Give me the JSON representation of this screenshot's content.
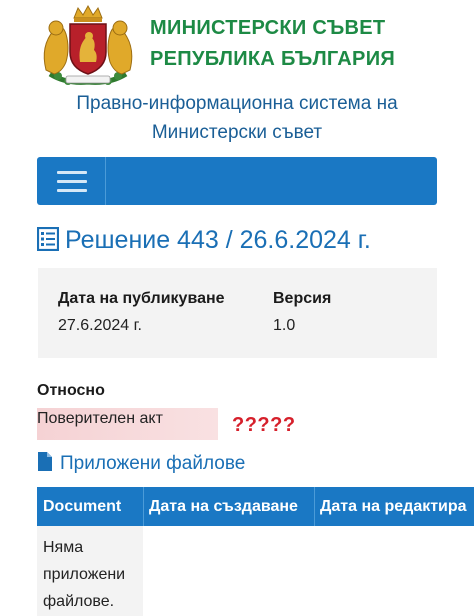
{
  "header": {
    "institution_line1": "МИНИСТЕРСКИ СЪВЕТ",
    "institution_line2": "РЕПУБЛИКА БЪЛГАРИЯ",
    "system_title_line1": "Правно-информационна система на",
    "system_title_line2": "Министерски съвет"
  },
  "colors": {
    "brand_green": "#1d8a45",
    "brand_blue": "#1a78c4",
    "title_blue": "#1a6fb5",
    "highlight_red": "#d6202b"
  },
  "icons": {
    "menu": "hamburger-icon",
    "document_list": "document-list-icon",
    "file": "file-icon"
  },
  "document": {
    "title": "Решение 443 / 26.6.2024 г.",
    "published_label": "Дата на публикуване",
    "published_value": "27.6.2024 г.",
    "version_label": "Версия",
    "version_value": "1.0",
    "subject_label": "Относно",
    "subject_value": "Поверителен акт",
    "annotation": "?????"
  },
  "files": {
    "title": "Приложени файлове",
    "columns": [
      "Document",
      "Дата на създаване",
      "Дата на редактира"
    ],
    "empty_text": "Няма приложени файлове."
  }
}
